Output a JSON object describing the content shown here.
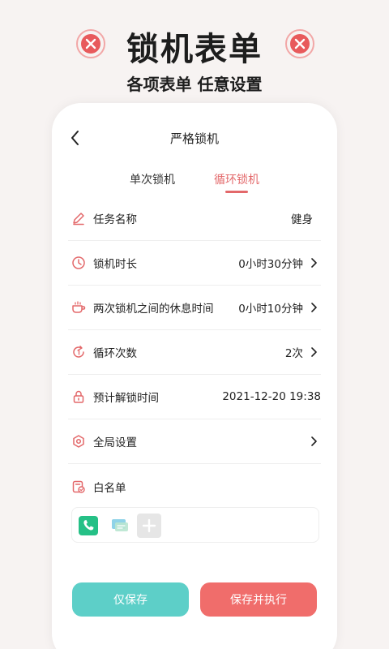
{
  "hero": {
    "title": "锁机表单",
    "subtitle": "各项表单  任意设置"
  },
  "nav": {
    "title": "严格锁机"
  },
  "tabs": [
    {
      "label": "单次锁机",
      "active": false
    },
    {
      "label": "循环锁机",
      "active": true
    }
  ],
  "form": {
    "task_name": {
      "label": "任务名称",
      "value": "健身"
    },
    "lock_duration": {
      "label": "锁机时长",
      "value": "0小时30分钟"
    },
    "rest_time": {
      "label": "两次锁机之间的休息时间",
      "value": "0小时10分钟"
    },
    "loop_count": {
      "label": "循环次数",
      "value": "2次"
    },
    "unlock_time": {
      "label": "预计解锁时间",
      "value": "2021-12-20 19:38"
    },
    "global_settings": {
      "label": "全局设置"
    },
    "whitelist": {
      "label": "白名单"
    }
  },
  "buttons": {
    "save_only": "仅保存",
    "save_execute": "保存并执行"
  },
  "colors": {
    "accent": "#e3686a",
    "save_button": "#5dcfc8",
    "execute_button": "#f06d6b",
    "phone_app": "#25c086"
  }
}
